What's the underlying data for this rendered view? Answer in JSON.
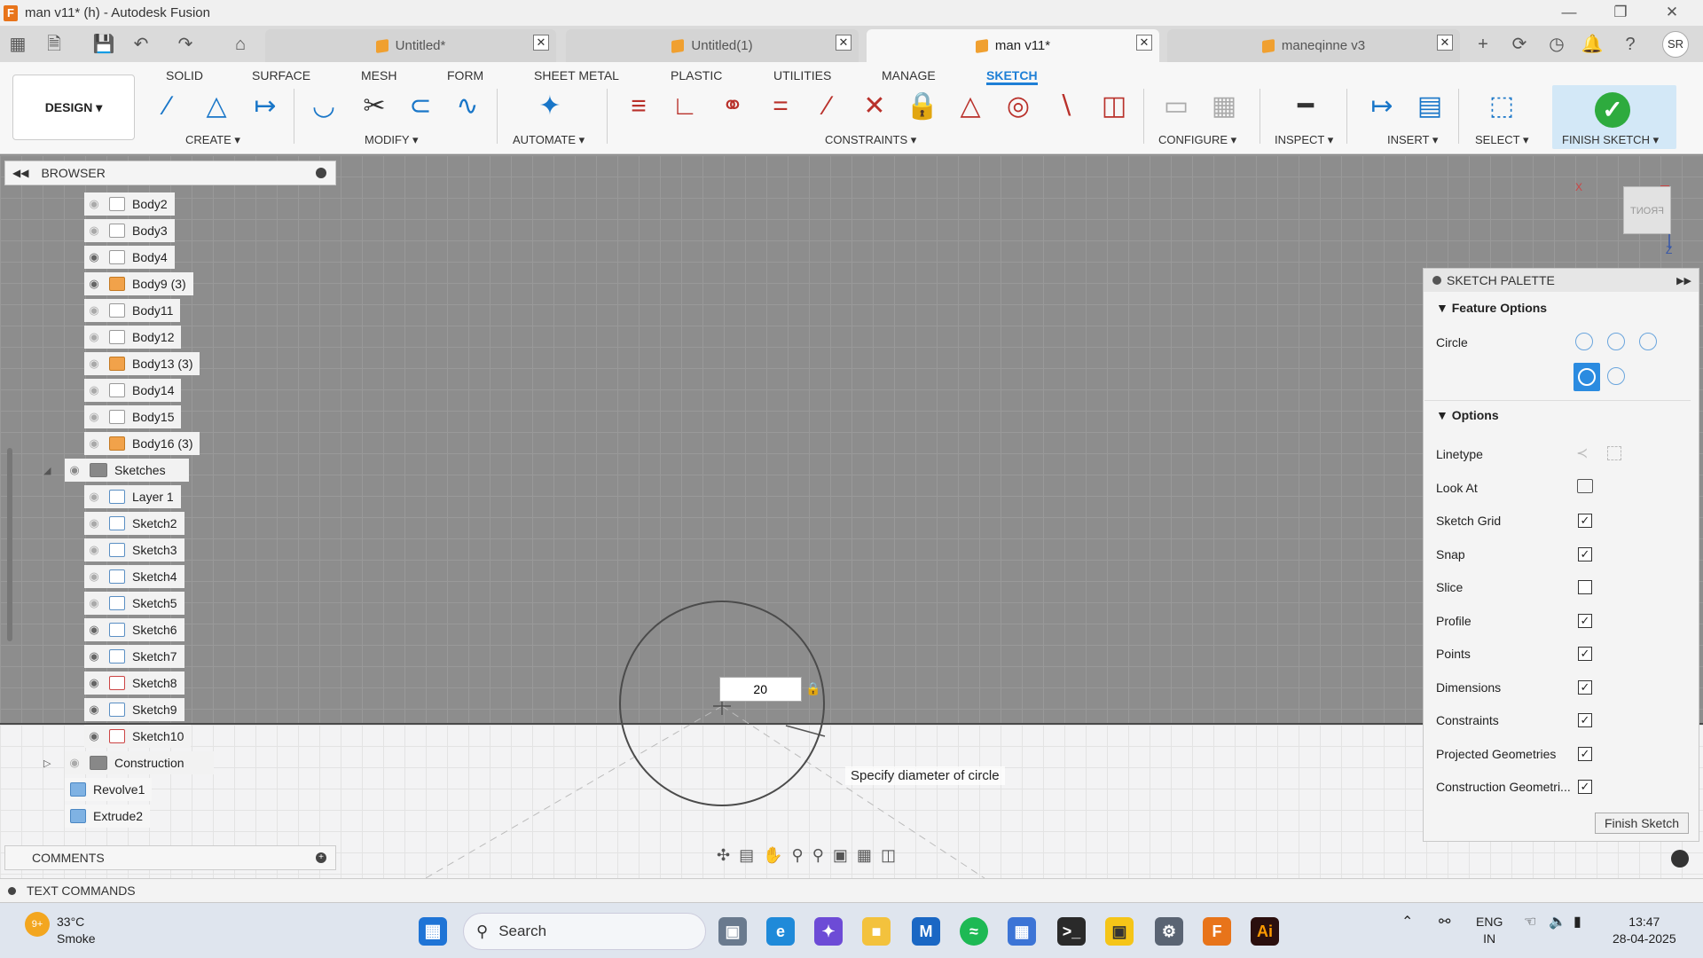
{
  "window": {
    "title": "man v11* (h) - Autodesk Fusion",
    "app_icon": "F"
  },
  "tabs": [
    {
      "label": "Untitled*"
    },
    {
      "label": "Untitled(1)"
    },
    {
      "label": "man v11*"
    },
    {
      "label": "maneqinne v3"
    }
  ],
  "user_initials": "SR",
  "ribbon": {
    "workspace": "DESIGN",
    "tabs": [
      "SOLID",
      "SURFACE",
      "MESH",
      "FORM",
      "SHEET METAL",
      "PLASTIC",
      "UTILITIES",
      "MANAGE",
      "SKETCH"
    ],
    "active_tab": "SKETCH",
    "groups": [
      "CREATE",
      "MODIFY",
      "AUTOMATE",
      "CONSTRAINTS",
      "CONFIGURE",
      "INSPECT",
      "INSERT",
      "SELECT",
      "FINISH SKETCH"
    ]
  },
  "browser": {
    "title": "BROWSER",
    "items": [
      {
        "label": "Body2"
      },
      {
        "label": "Body3"
      },
      {
        "label": "Body4"
      },
      {
        "label": "Body9 (3)"
      },
      {
        "label": "Body11"
      },
      {
        "label": "Body12"
      },
      {
        "label": "Body13 (3)"
      },
      {
        "label": "Body14"
      },
      {
        "label": "Body15"
      },
      {
        "label": "Body16 (3)"
      },
      {
        "label": "Sketches"
      },
      {
        "label": "Layer 1"
      },
      {
        "label": "Sketch2"
      },
      {
        "label": "Sketch3"
      },
      {
        "label": "Sketch4"
      },
      {
        "label": "Sketch5"
      },
      {
        "label": "Sketch6"
      },
      {
        "label": "Sketch7"
      },
      {
        "label": "Sketch8"
      },
      {
        "label": "Sketch9"
      },
      {
        "label": "Sketch10"
      },
      {
        "label": "Construction"
      },
      {
        "label": "Revolve1"
      },
      {
        "label": "Extrude2"
      }
    ]
  },
  "canvas": {
    "dimension_value": "20",
    "tooltip": "Specify diameter of circle",
    "viewcube_label": "FRONT",
    "axis_x": "X",
    "axis_z": "Z"
  },
  "sketch_palette": {
    "title": "SKETCH PALETTE",
    "feature_options_title": "Feature Options",
    "circle_label": "Circle",
    "options_title": "Options",
    "linetype_label": "Linetype",
    "look_at_label": "Look At",
    "checkboxes": [
      {
        "label": "Sketch Grid",
        "checked": true
      },
      {
        "label": "Snap",
        "checked": true
      },
      {
        "label": "Slice",
        "checked": false
      },
      {
        "label": "Profile",
        "checked": true
      },
      {
        "label": "Points",
        "checked": true
      },
      {
        "label": "Dimensions",
        "checked": true
      },
      {
        "label": "Constraints",
        "checked": true
      },
      {
        "label": "Projected Geometries",
        "checked": true
      },
      {
        "label": "Construction Geometri...",
        "checked": true
      }
    ],
    "finish_button": "Finish Sketch"
  },
  "comments": {
    "title": "COMMENTS"
  },
  "text_commands": {
    "title": "TEXT COMMANDS"
  },
  "taskbar": {
    "weather_temp": "33°C",
    "weather_desc": "Smoke",
    "weather_badge": "9+",
    "search_placeholder": "Search",
    "lang_top": "ENG",
    "lang_bottom": "IN",
    "time": "13:47",
    "date": "28-04-2025"
  }
}
